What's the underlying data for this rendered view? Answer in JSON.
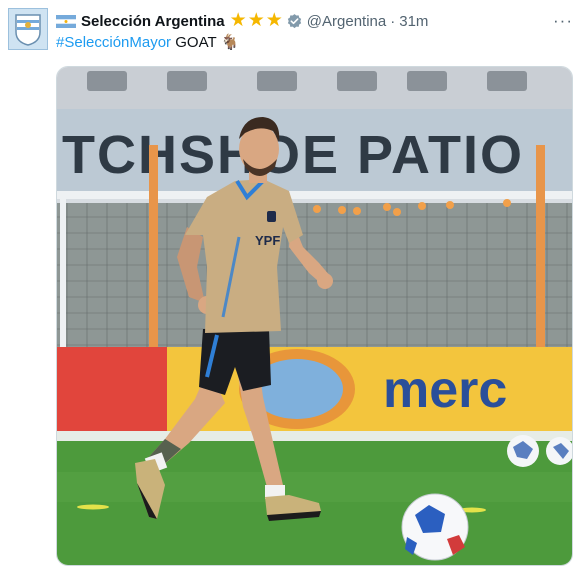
{
  "tweet": {
    "author": {
      "display_name": "Selección Argentina",
      "handle": "@Argentina",
      "verified": true,
      "flag_icon": "argentina-flag-icon",
      "star_icon": "star-icon",
      "star_count": 3
    },
    "separator": "·",
    "time": "31m",
    "more_label": "···",
    "text": {
      "hashtag": "#SelecciónMayor",
      "body": "GOAT",
      "emoji": "🐐"
    },
    "media": {
      "banner_text": "ITCHSHOE PATIO",
      "sponsor_text": "merc",
      "shirt_text": "YPF"
    }
  },
  "colors": {
    "link": "#1d9bf0",
    "star": "#f5b700",
    "secondary": "#536471",
    "pitch": "#4d9a3c"
  }
}
